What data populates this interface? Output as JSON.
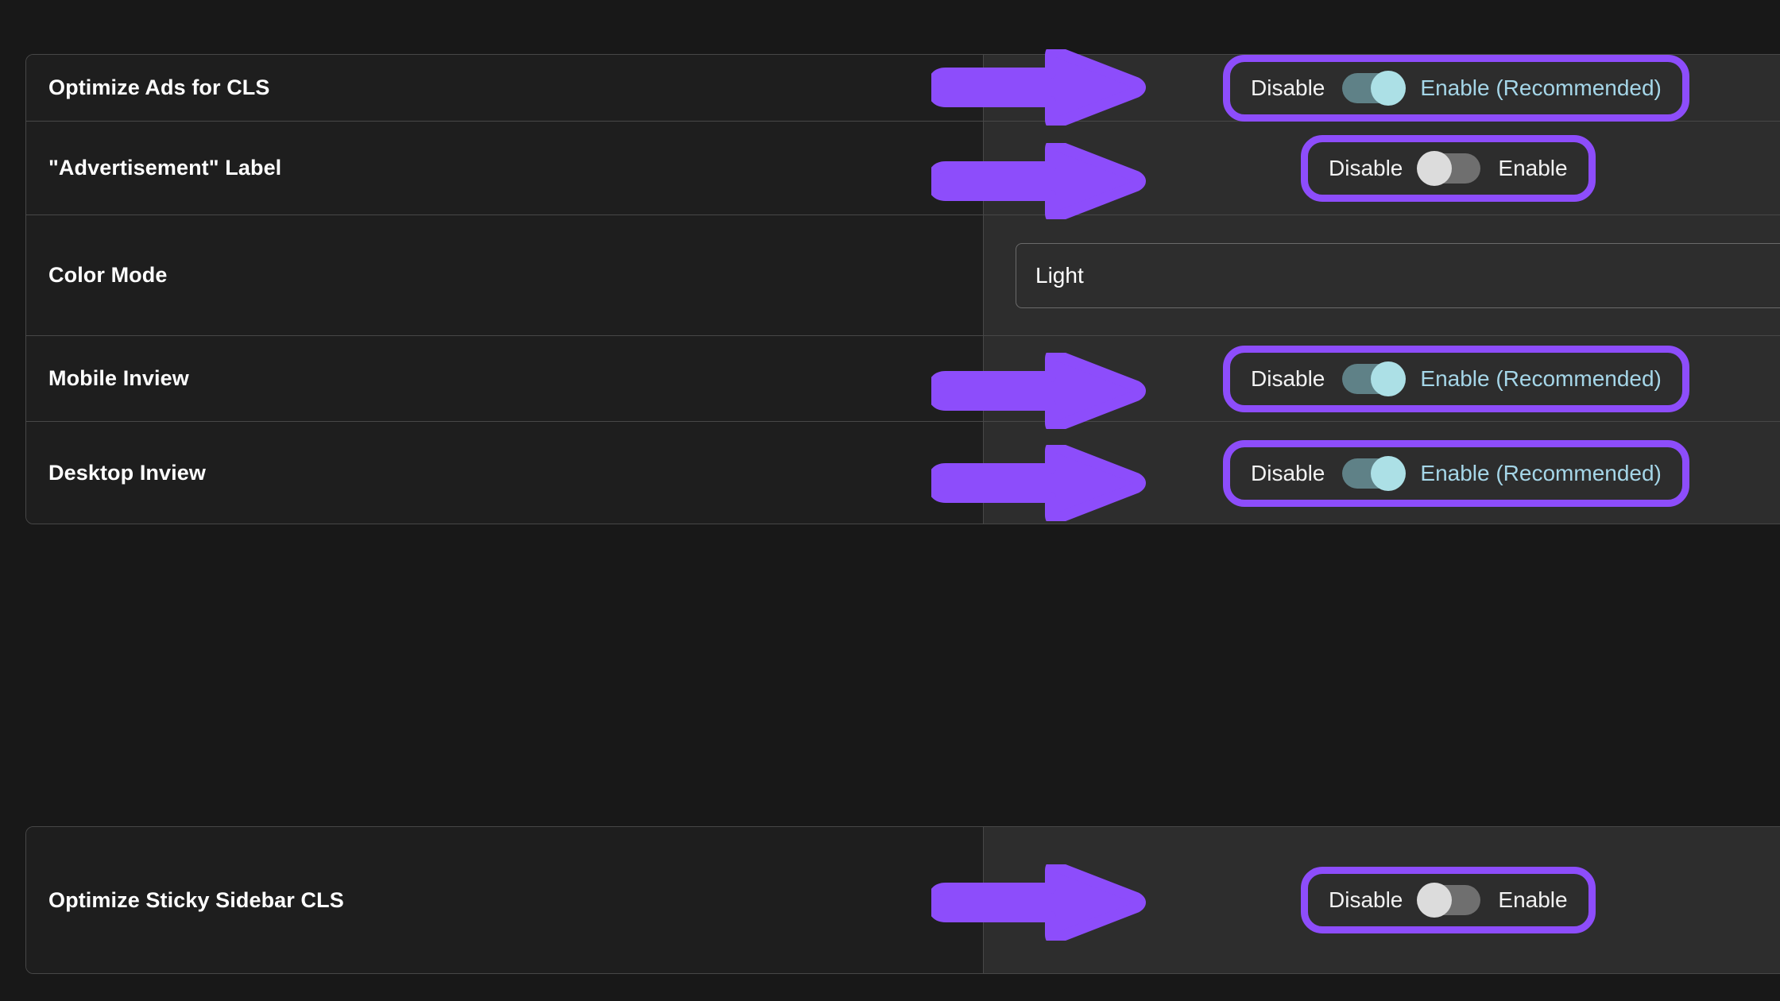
{
  "theme": {
    "page_background": "#181818",
    "card_background": "#1e1e1e",
    "control_background": "#2d2d2d",
    "border": "#474747",
    "annotation_purple": "#8d4dfb",
    "toggle_on_track": "#5f8187",
    "toggle_on_knob": "#ace0e6",
    "toggle_off_track": "#6f6f6f",
    "toggle_off_knob": "#dcdcdc",
    "recommended_text": "#a5d6e8",
    "label_text": "#ffffff"
  },
  "labels": {
    "disable": "Disable",
    "enable": "Enable",
    "enable_recommended": "Enable (Recommended)"
  },
  "main_card": {
    "rows": [
      {
        "name": "optimize-ads-for-cls",
        "label": "Optimize Ads for CLS",
        "control": "toggle",
        "state": "on",
        "off_label": "Disable",
        "on_label": "Enable (Recommended)",
        "highlighted": true,
        "arrow": true
      },
      {
        "name": "advertisement-label",
        "label": "\"Advertisement\" Label",
        "control": "toggle",
        "state": "off",
        "off_label": "Disable",
        "on_label": "Enable",
        "highlighted": true,
        "arrow": true
      },
      {
        "name": "color-mode",
        "label": "Color Mode",
        "control": "select",
        "value": "Light",
        "highlighted": false,
        "arrow": false
      },
      {
        "name": "mobile-inview",
        "label": "Mobile Inview",
        "control": "toggle",
        "state": "on",
        "off_label": "Disable",
        "on_label": "Enable (Recommended)",
        "highlighted": true,
        "arrow": true
      },
      {
        "name": "desktop-inview",
        "label": "Desktop Inview",
        "control": "toggle",
        "state": "on",
        "off_label": "Disable",
        "on_label": "Enable (Recommended)",
        "highlighted": true,
        "arrow": true
      }
    ]
  },
  "extra_card": {
    "rows": [
      {
        "name": "optimize-sticky-sidebar-cls",
        "label": "Optimize Sticky Sidebar CLS",
        "control": "toggle",
        "state": "off",
        "off_label": "Disable",
        "on_label": "Enable",
        "highlighted": true,
        "arrow": true
      }
    ]
  }
}
